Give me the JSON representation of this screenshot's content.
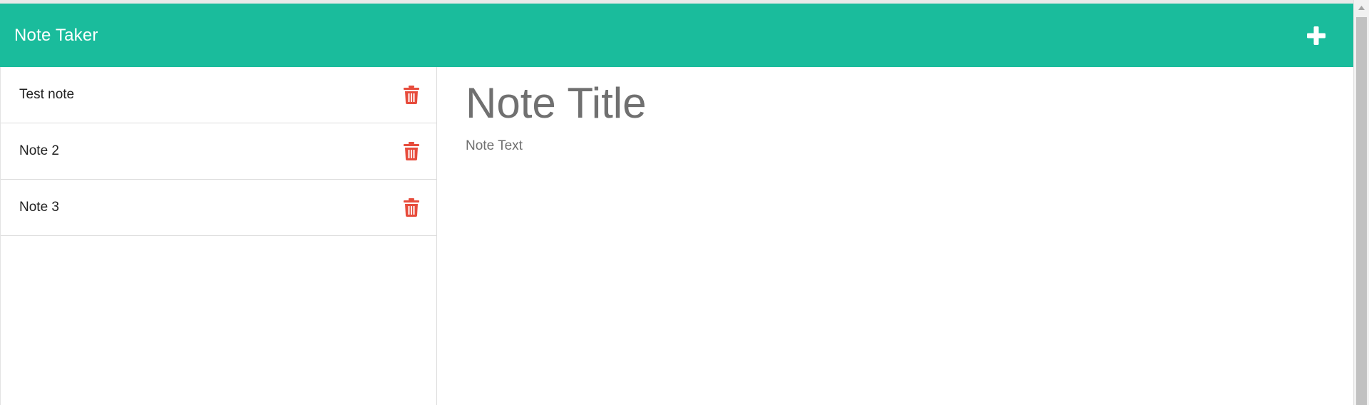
{
  "app": {
    "title": "Note Taker",
    "accent_color": "#1abc9c",
    "delete_color": "#e74c3c"
  },
  "navbar": {
    "add_icon": "plus-icon"
  },
  "notes": [
    {
      "title": "Test note",
      "delete_icon": "trash-icon"
    },
    {
      "title": "Note 2",
      "delete_icon": "trash-icon"
    },
    {
      "title": "Note 3",
      "delete_icon": "trash-icon"
    }
  ],
  "editor": {
    "title_placeholder": "Note Title",
    "text_placeholder": "Note Text",
    "title_value": "",
    "text_value": ""
  }
}
